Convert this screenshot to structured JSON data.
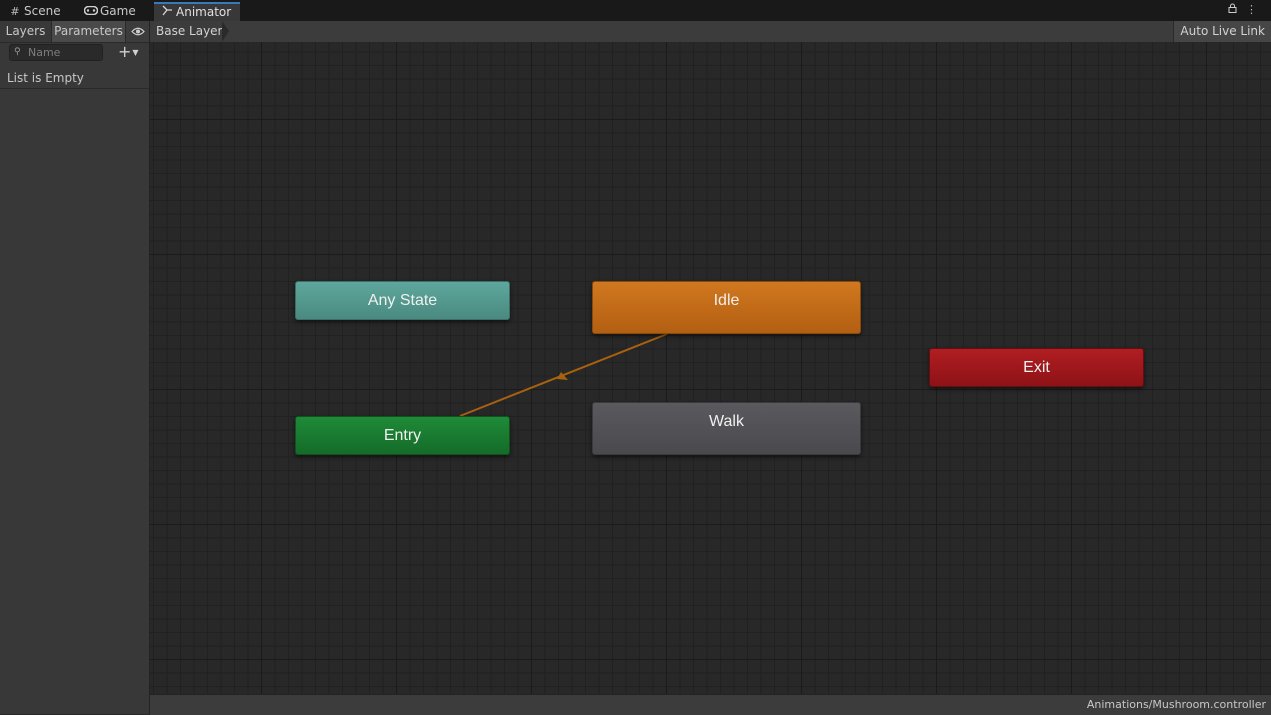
{
  "tabs": [
    {
      "label": "Scene",
      "icon": "grid-icon"
    },
    {
      "label": "Game",
      "icon": "gamepad-icon"
    },
    {
      "label": "Animator",
      "icon": "animator-icon"
    }
  ],
  "left_panel": {
    "tab_layers": "Layers",
    "tab_parameters": "Parameters",
    "search_placeholder": "Name",
    "empty_text": "List is Empty"
  },
  "breadcrumb": "Base Layer",
  "auto_live_link": "Auto Live Link",
  "states": {
    "any_state": "Any State",
    "idle": "Idle",
    "entry": "Entry",
    "walk": "Walk",
    "exit": "Exit"
  },
  "colors": {
    "any_state": "#5ea79c",
    "idle": "#d0781f",
    "entry": "#1f8a38",
    "walk": "#5a5a5e",
    "exit": "#b01e22",
    "transition": "#a8620f",
    "active_tab_accent": "#3a79bb"
  },
  "footer_path": "Animations/Mushroom.controller"
}
